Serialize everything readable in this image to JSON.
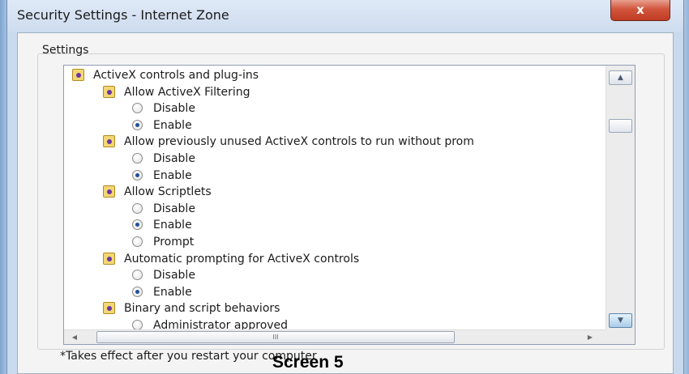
{
  "window": {
    "title": "Security Settings - Internet Zone",
    "close_label": "x"
  },
  "settings": {
    "group_label": "Settings",
    "items": [
      {
        "kind": "category",
        "label": "ActiveX controls and plug-ins"
      },
      {
        "kind": "setting",
        "label": "Allow ActiveX Filtering"
      },
      {
        "kind": "option",
        "label": "Disable",
        "checked": false
      },
      {
        "kind": "option",
        "label": "Enable",
        "checked": true
      },
      {
        "kind": "setting",
        "label": "Allow previously unused ActiveX controls to run without prom"
      },
      {
        "kind": "option",
        "label": "Disable",
        "checked": false
      },
      {
        "kind": "option",
        "label": "Enable",
        "checked": true
      },
      {
        "kind": "setting",
        "label": "Allow Scriptlets"
      },
      {
        "kind": "option",
        "label": "Disable",
        "checked": false
      },
      {
        "kind": "option",
        "label": "Enable",
        "checked": true
      },
      {
        "kind": "option",
        "label": "Prompt",
        "checked": false
      },
      {
        "kind": "setting",
        "label": "Automatic prompting for ActiveX controls"
      },
      {
        "kind": "option",
        "label": "Disable",
        "checked": false
      },
      {
        "kind": "option",
        "label": "Enable",
        "checked": true
      },
      {
        "kind": "setting",
        "label": "Binary and script behaviors"
      },
      {
        "kind": "option",
        "label": "Administrator approved",
        "checked": false
      }
    ]
  },
  "scrollbar": {
    "up_icon": "scroll-up-arrow",
    "down_icon": "scroll-down-arrow",
    "h_grip_text": "III"
  },
  "footnote": "*Takes effect after you restart your computer",
  "caption": "Screen 5",
  "colors": {
    "close_button": "#c9442a",
    "selected_radio": "#1f4f9a",
    "category_icon": "#f3d774"
  }
}
